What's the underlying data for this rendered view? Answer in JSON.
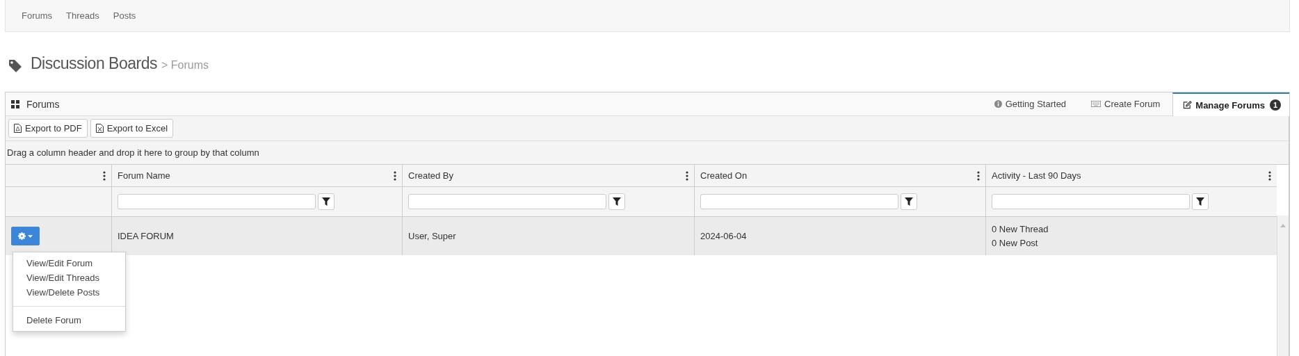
{
  "top_nav": [
    {
      "label": "Forums"
    },
    {
      "label": "Threads"
    },
    {
      "label": "Posts"
    }
  ],
  "page_title": {
    "title": "Discussion Boards",
    "crumb": "> Forums"
  },
  "panel": {
    "title": "Forums",
    "tabs": [
      {
        "label": "Getting Started",
        "kind": "info",
        "selected": false
      },
      {
        "label": "Create Forum",
        "kind": "create",
        "selected": false
      },
      {
        "label": "Manage Forums",
        "kind": "manage",
        "badge": "1",
        "selected": true
      }
    ],
    "toolbar": [
      {
        "label": "Export to PDF",
        "kind": "pdf"
      },
      {
        "label": "Export to Excel",
        "kind": "excel"
      }
    ],
    "group_hint": "Drag a column header and drop it here to group by that column",
    "columns": [
      {
        "label": "Forum Name"
      },
      {
        "label": "Created By"
      },
      {
        "label": "Created On"
      },
      {
        "label": "Activity - Last 90 Days"
      }
    ],
    "rows": [
      {
        "selected": true,
        "actions_expanded": true,
        "cells": [
          "IDEA FORUM",
          "User, Super",
          "2024-06-04",
          "0 New Thread\n0 New Post"
        ]
      }
    ],
    "row_menu": [
      {
        "kind": "item",
        "label": "View/Edit Forum"
      },
      {
        "kind": "item",
        "label": "View/Edit Threads"
      },
      {
        "kind": "item",
        "label": "View/Delete Posts"
      },
      {
        "kind": "divider"
      },
      {
        "kind": "item",
        "label": "Delete Forum"
      }
    ]
  }
}
